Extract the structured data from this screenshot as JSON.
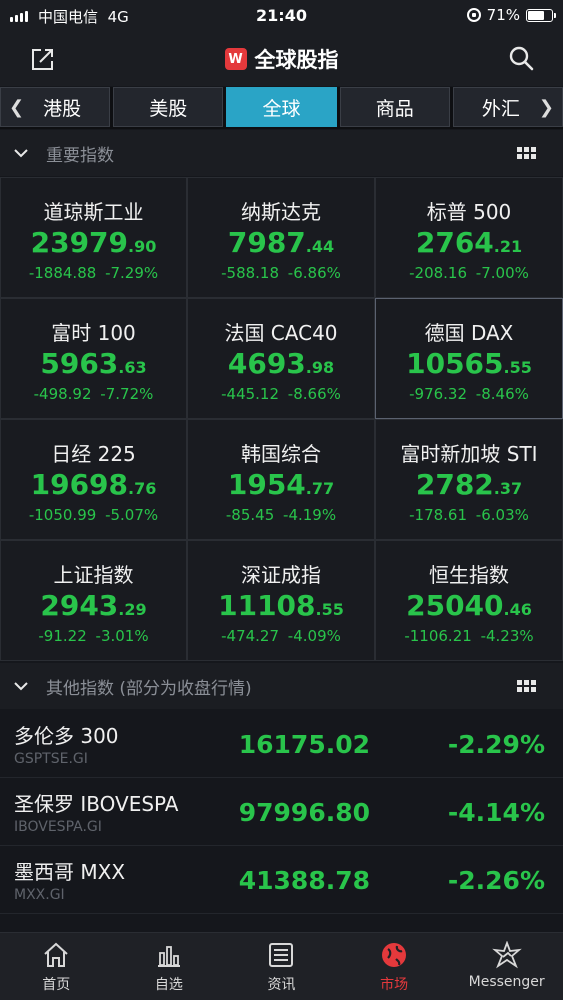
{
  "status_bar": {
    "carrier": "中国电信",
    "network": "4G",
    "time": "21:40",
    "battery": "71%",
    "battery_level": 0.71
  },
  "nav": {
    "logo_letter": "W",
    "title": "全球股指"
  },
  "tabs": [
    {
      "label": "港股",
      "active": false
    },
    {
      "label": "美股",
      "active": false
    },
    {
      "label": "全球",
      "active": true
    },
    {
      "label": "商品",
      "active": false
    },
    {
      "label": "外汇",
      "active": false
    }
  ],
  "section_main": {
    "title": "重要指数"
  },
  "indices": [
    {
      "name": "道琼斯工业",
      "int": "23979",
      "dec": ".90",
      "change": "-1884.88",
      "pct": "-7.29%"
    },
    {
      "name": "纳斯达克",
      "int": "7987",
      "dec": ".44",
      "change": "-588.18",
      "pct": "-6.86%"
    },
    {
      "name": "标普 500",
      "int": "2764",
      "dec": ".21",
      "change": "-208.16",
      "pct": "-7.00%"
    },
    {
      "name": "富时 100",
      "int": "5963",
      "dec": ".63",
      "change": "-498.92",
      "pct": "-7.72%"
    },
    {
      "name": "法国 CAC40",
      "int": "4693",
      "dec": ".98",
      "change": "-445.12",
      "pct": "-8.66%"
    },
    {
      "name": "德国 DAX",
      "int": "10565",
      "dec": ".55",
      "change": "-976.32",
      "pct": "-8.46%"
    },
    {
      "name": "日经 225",
      "int": "19698",
      "dec": ".76",
      "change": "-1050.99",
      "pct": "-5.07%"
    },
    {
      "name": "韩国综合",
      "int": "1954",
      "dec": ".77",
      "change": "-85.45",
      "pct": "-4.19%"
    },
    {
      "name": "富时新加坡 STI",
      "int": "2782",
      "dec": ".37",
      "change": "-178.61",
      "pct": "-6.03%"
    },
    {
      "name": "上证指数",
      "int": "2943",
      "dec": ".29",
      "change": "-91.22",
      "pct": "-3.01%"
    },
    {
      "name": "深证成指",
      "int": "11108",
      "dec": ".55",
      "change": "-474.27",
      "pct": "-4.09%"
    },
    {
      "name": "恒生指数",
      "int": "25040",
      "dec": ".46",
      "change": "-1106.21",
      "pct": "-4.23%"
    }
  ],
  "section_other": {
    "title": "其他指数 (部分为收盘行情)"
  },
  "other_indices": [
    {
      "name": "多伦多 300",
      "code": "GSPTSE.GI",
      "price": "16175.02",
      "pct": "-2.29%"
    },
    {
      "name": "圣保罗 IBOVESPA",
      "code": "IBOVESPA.GI",
      "price": "97996.80",
      "pct": "-4.14%"
    },
    {
      "name": "墨西哥 MXX",
      "code": "MXX.GI",
      "price": "41388.78",
      "pct": "-2.26%"
    }
  ],
  "bottom_tabs": [
    {
      "label": "首页",
      "icon": "home-icon",
      "active": false
    },
    {
      "label": "自选",
      "icon": "chart-icon",
      "active": false
    },
    {
      "label": "资讯",
      "icon": "news-icon",
      "active": false
    },
    {
      "label": "市场",
      "icon": "globe-icon",
      "active": true
    },
    {
      "label": "Messenger",
      "icon": "messenger-icon",
      "active": false
    }
  ],
  "colors": {
    "down_green": "#29c44b",
    "tab_active": "#2aa4c6",
    "brand_red": "#e4393c"
  }
}
